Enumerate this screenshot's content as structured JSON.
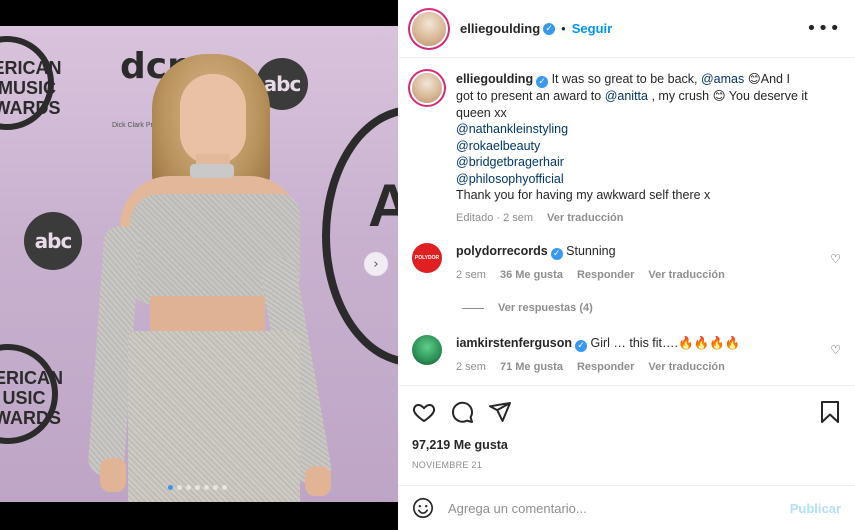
{
  "post": {
    "username": "elliegoulding",
    "follow_label": "Seguir",
    "separator": "•",
    "more_label": "•••",
    "verified_glyph": "✓"
  },
  "caption": {
    "username": "elliegoulding",
    "text_1": "It was so great to be back, ",
    "mention_amas": "@amas",
    "emoji_1": "😊",
    "text_2": "And I got to present an award to ",
    "mention_anitta": "@anitta",
    "text_3": " , my crush ",
    "emoji_2": "😊",
    "text_4": " You deserve it queen xx",
    "mention_1": "@nathankleinstyling",
    "mention_2": "@rokaelbeauty",
    "mention_3": "@bridgetbragerhair",
    "mention_4": "@philosophyofficial",
    "text_5": "Thank you for having my awkward self there x",
    "edited": "Editado · 2 sem",
    "translate": "Ver traducción"
  },
  "comments": [
    {
      "username": "polydorrecords",
      "avatar_text": "POLYDOR",
      "text": "Stunning",
      "time": "2 sem",
      "likes": "36 Me gusta",
      "reply": "Responder",
      "translate": "Ver traducción",
      "view_replies": "Ver respuestas (4)"
    },
    {
      "username": "iamkirstenferguson",
      "text": "Girl … this fit….🔥🔥🔥🔥",
      "time": "2 sem",
      "likes": "71 Me gusta",
      "reply": "Responder",
      "translate": "Ver traducción"
    }
  ],
  "footer": {
    "likes": "97,219 Me gusta",
    "date": "NOVIEMBRE 21",
    "comment_placeholder": "Agrega un comentario...",
    "publish_label": "Publicar"
  },
  "media": {
    "ama_text_1": "ERICAN\nMUSIC\nWARDS",
    "ama_text_2": "ERICAN\nUSIC\nWARDS",
    "abc_label": "abc",
    "dcp_label": "dcp",
    "dcp_sub": "Dick Clark Pro",
    "next_glyph": "›",
    "letter_a": "A"
  },
  "colors": {
    "accent": "#0095f6",
    "verified": "#3897f0",
    "mention": "#00376b",
    "muted": "#8e8e8e"
  },
  "icons": {
    "more": "more-icon",
    "heart": "heart-icon",
    "comment": "comment-icon",
    "share": "share-icon",
    "bookmark": "bookmark-icon",
    "emoji": "emoji-icon",
    "next": "chevron-right-icon"
  },
  "carousel": {
    "count": 7,
    "active_index": 0
  }
}
